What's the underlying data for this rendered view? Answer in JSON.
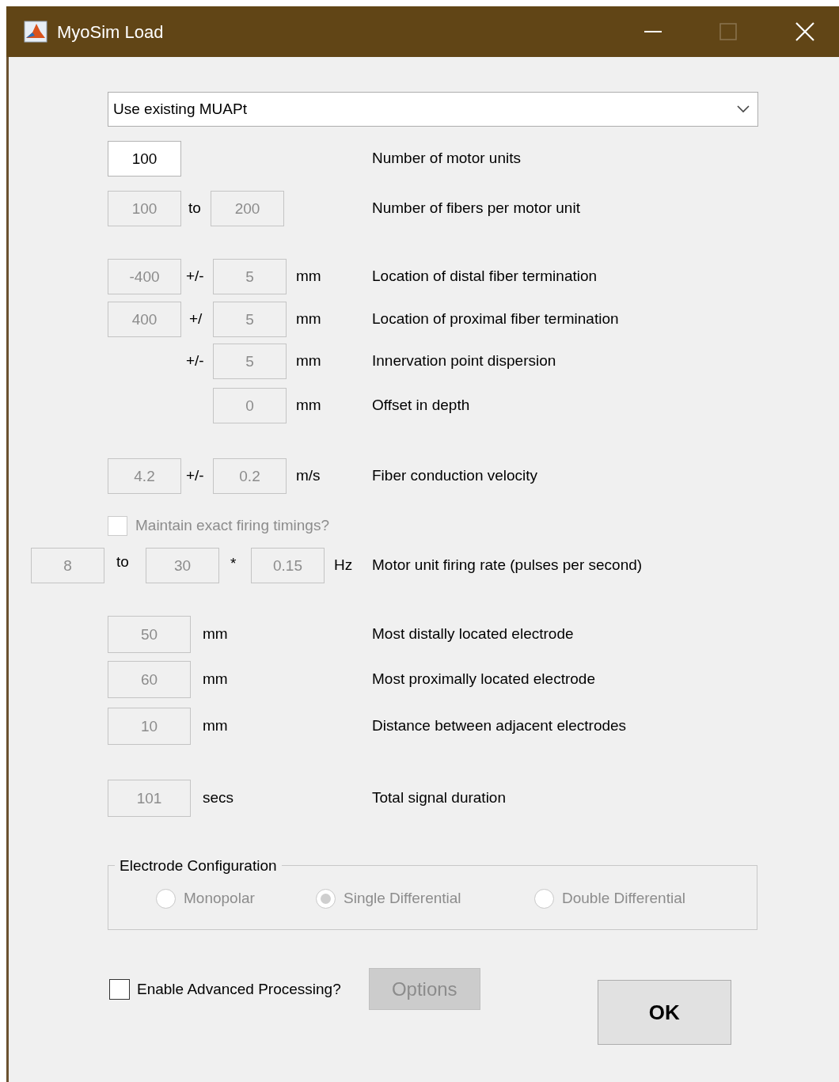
{
  "window": {
    "title": "MyoSim Load"
  },
  "model_dropdown": {
    "value": "Use existing MUAPt"
  },
  "motor_units": {
    "field": {
      "value": "100",
      "disabled": false
    },
    "label": "Number of motor units"
  },
  "fibers_per_unit": {
    "min": {
      "value": "100",
      "disabled": true
    },
    "to": "to",
    "max": {
      "value": "200",
      "disabled": true
    },
    "label": "Number of fibers per motor unit"
  },
  "distal_termination": {
    "location": {
      "value": "-400",
      "disabled": true
    },
    "tolerance_sign": "+/-",
    "tolerance": {
      "value": "5",
      "disabled": true
    },
    "unit": "mm",
    "label": "Location of distal fiber termination"
  },
  "proximal_termination": {
    "location": {
      "value": "400",
      "disabled": true
    },
    "tolerance_sign": "+/",
    "tolerance": {
      "value": "5",
      "disabled": true
    },
    "unit": "mm",
    "label": "Location of proximal fiber termination"
  },
  "innervation_dispersion": {
    "tolerance_sign": "+/-",
    "tolerance": {
      "value": "5",
      "disabled": true
    },
    "unit": "mm",
    "label": "Innervation point dispersion"
  },
  "depth_offset": {
    "field": {
      "value": "0",
      "disabled": true
    },
    "unit": "mm",
    "label": "Offset in depth"
  },
  "conduction_velocity": {
    "mean": {
      "value": "4.2",
      "disabled": true
    },
    "tolerance_sign": "+/-",
    "tolerance": {
      "value": "0.2",
      "disabled": true
    },
    "unit": "m/s",
    "label": "Fiber conduction velocity"
  },
  "maintain_timings": {
    "label": "Maintain exact firing timings?",
    "checked": false,
    "disabled": true
  },
  "firing_rate": {
    "min": {
      "value": "8",
      "disabled": true
    },
    "to": "to",
    "max": {
      "value": "30",
      "disabled": true
    },
    "times": "*",
    "scale": {
      "value": "0.15",
      "disabled": true
    },
    "unit": "Hz",
    "label": "Motor unit firing rate (pulses per second)"
  },
  "distal_electrode": {
    "field": {
      "value": "50",
      "disabled": true
    },
    "unit": "mm",
    "label": "Most distally located electrode"
  },
  "proximal_electrode": {
    "field": {
      "value": "60",
      "disabled": true
    },
    "unit": "mm",
    "label": "Most proximally located electrode"
  },
  "electrode_spacing": {
    "field": {
      "value": "10",
      "disabled": true
    },
    "unit": "mm",
    "label": "Distance between adjacent electrodes"
  },
  "signal_duration": {
    "field": {
      "value": "101",
      "disabled": true
    },
    "unit": "secs",
    "label": "Total signal duration"
  },
  "electrode_configuration": {
    "title": "Electrode Configuration",
    "options": [
      {
        "label": "Monopolar",
        "selected": false,
        "disabled": true
      },
      {
        "label": "Single Differential",
        "selected": true,
        "disabled": true
      },
      {
        "label": "Double Differential",
        "selected": false,
        "disabled": true
      }
    ]
  },
  "advanced_processing": {
    "label": "Enable Advanced Processing?",
    "checked": false,
    "disabled": false
  },
  "options_button": {
    "label": "Options",
    "disabled": true
  },
  "ok_button": {
    "label": "OK"
  }
}
